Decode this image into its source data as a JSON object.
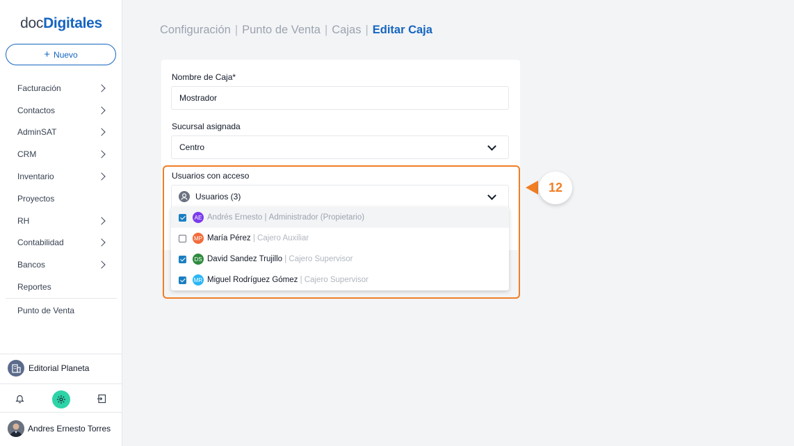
{
  "brand": {
    "doc": "doc",
    "digitales": "Digitales"
  },
  "sidebar": {
    "new_label": "Nuevo",
    "items": [
      {
        "label": "Facturación",
        "chevron": true
      },
      {
        "label": "Contactos",
        "chevron": true
      },
      {
        "label": "AdminSAT",
        "chevron": true
      },
      {
        "label": "CRM",
        "chevron": true
      },
      {
        "label": "Inventario",
        "chevron": true
      },
      {
        "label": "Proyectos",
        "chevron": false
      },
      {
        "label": "RH",
        "chevron": true
      },
      {
        "label": "Contabilidad",
        "chevron": true
      },
      {
        "label": "Bancos",
        "chevron": true
      },
      {
        "label": "Reportes",
        "chevron": false
      }
    ],
    "pos_label": "Punto de Venta",
    "company": "Editorial Planeta",
    "user": "Andres Ernesto Torres"
  },
  "breadcrumb": {
    "items": [
      "Configuración",
      "Punto de Venta",
      "Cajas"
    ],
    "current": "Editar Caja",
    "separator": "|"
  },
  "form": {
    "name_label": "Nombre de Caja*",
    "name_value": "Mostrador",
    "branch_label": "Sucursal asignada",
    "branch_value": "Centro",
    "users_label": "Usuarios con acceso",
    "users_value": "Usuarios (3)"
  },
  "users": [
    {
      "initials": "AE",
      "name": "Andrés Ernesto",
      "role": "Administrador (Propietario)",
      "checked": true,
      "disabled": true,
      "color": "#7c3aed"
    },
    {
      "initials": "MP",
      "name": "María Pérez",
      "role": "Cajero Auxiliar",
      "checked": false,
      "disabled": false,
      "color": "#f26b3a"
    },
    {
      "initials": "DS",
      "name": "David Sandez Trujillo",
      "role": "Cajero Supervisor",
      "checked": true,
      "disabled": false,
      "color": "#2e8b3e"
    },
    {
      "initials": "MR",
      "name": "Miguel Rodríguez Gómez",
      "role": "Cajero Supervisor",
      "checked": true,
      "disabled": false,
      "color": "#29b6f6"
    }
  ],
  "callout": {
    "number": "12"
  },
  "colors": {
    "accent": "#1565c0",
    "highlight": "#f07e25",
    "gear": "#2dd4a7"
  }
}
